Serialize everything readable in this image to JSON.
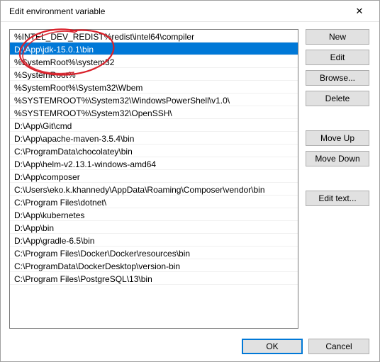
{
  "window": {
    "title": "Edit environment variable"
  },
  "list": {
    "items": [
      "%INTEL_DEV_REDIST%redist\\intel64\\compiler",
      "D:\\App\\jdk-15.0.1\\bin",
      "%SystemRoot%\\system32",
      "%SystemRoot%",
      "%SystemRoot%\\System32\\Wbem",
      "%SYSTEMROOT%\\System32\\WindowsPowerShell\\v1.0\\",
      "%SYSTEMROOT%\\System32\\OpenSSH\\",
      "D:\\App\\Git\\cmd",
      "D:\\App\\apache-maven-3.5.4\\bin",
      "C:\\ProgramData\\chocolatey\\bin",
      "D:\\App\\helm-v2.13.1-windows-amd64",
      "D:\\App\\composer",
      "C:\\Users\\eko.k.khannedy\\AppData\\Roaming\\Composer\\vendor\\bin",
      "C:\\Program Files\\dotnet\\",
      "D:\\App\\kubernetes",
      "D:\\App\\bin",
      "D:\\App\\gradle-6.5\\bin",
      "C:\\Program Files\\Docker\\Docker\\resources\\bin",
      "C:\\ProgramData\\DockerDesktop\\version-bin",
      "C:\\Program Files\\PostgreSQL\\13\\bin"
    ],
    "selected_index": 1
  },
  "buttons": {
    "new": "New",
    "edit": "Edit",
    "browse": "Browse...",
    "delete": "Delete",
    "move_up": "Move Up",
    "move_down": "Move Down",
    "edit_text": "Edit text...",
    "ok": "OK",
    "cancel": "Cancel"
  }
}
